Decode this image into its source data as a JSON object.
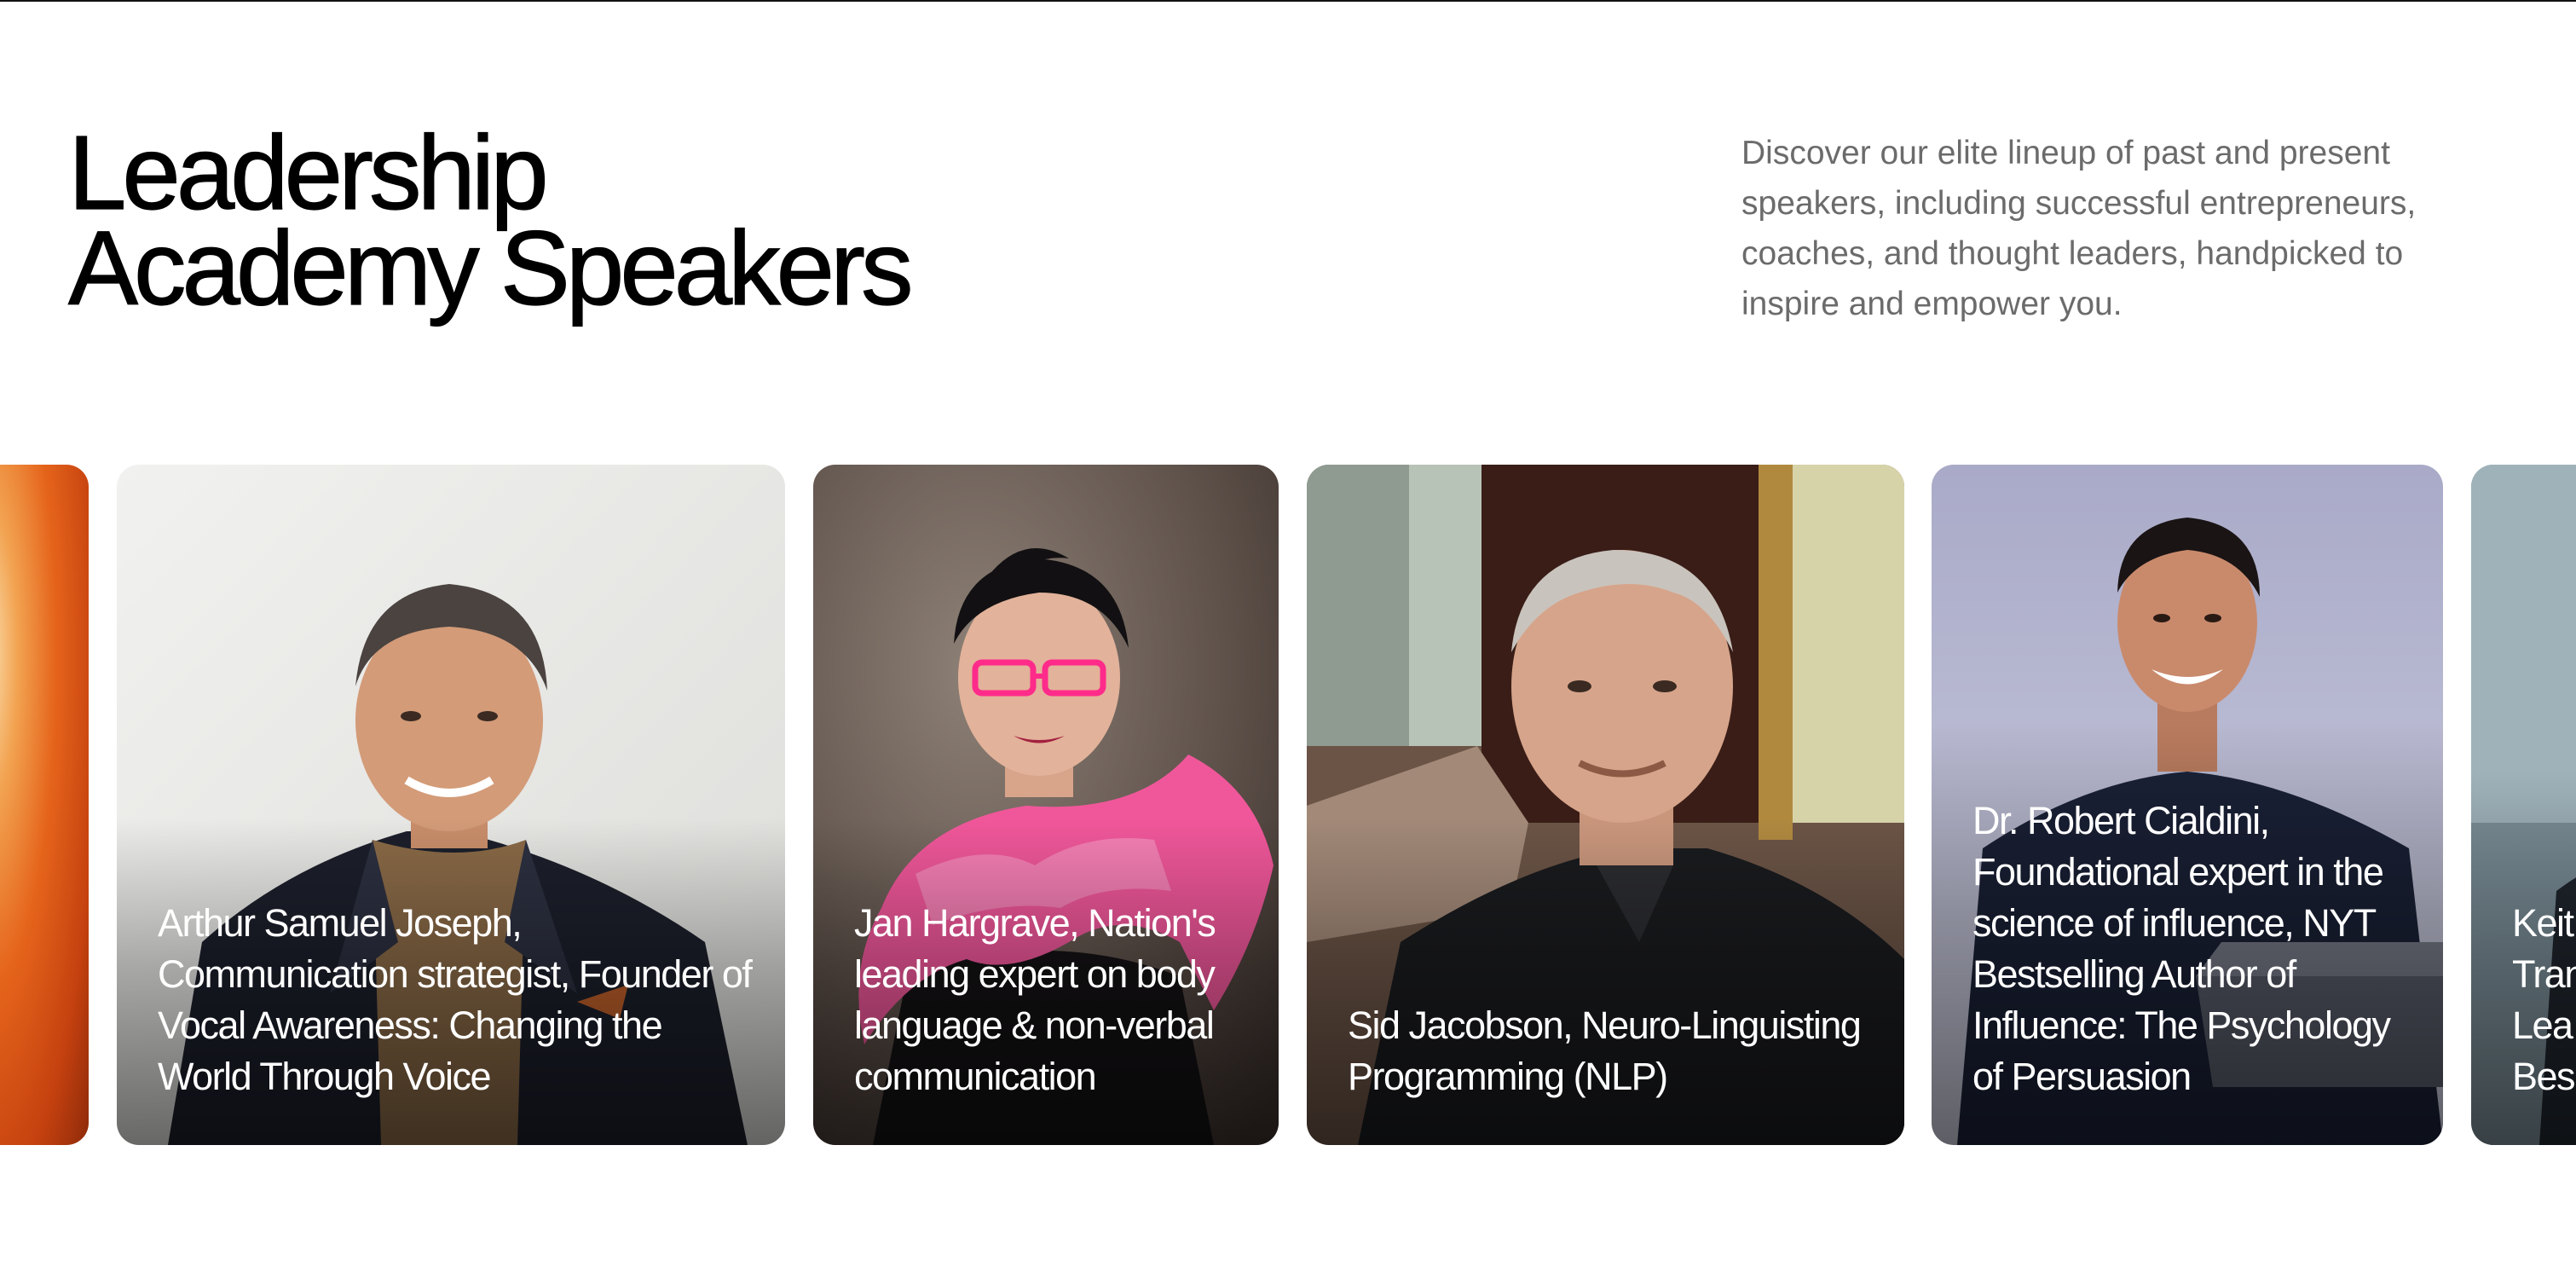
{
  "header": {
    "title_line1": "Leadership",
    "title_line2": "Academy Speakers",
    "intro": "Discover our elite lineup of past and present speakers, including successful entrepreneurs, coaches, and thought leaders, handpicked to inspire and empower you."
  },
  "speakers": [
    {
      "caption": "Arthur Samuel Joseph, Communication strategist, Founder of Vocal Awareness: Changing the World Through Voice"
    },
    {
      "caption": "Jan Hargrave, Nation's leading expert on body language & non-verbal communication"
    },
    {
      "caption": "Sid Jacobson, Neuro-Linguisting Programming (NLP)"
    },
    {
      "caption": "Dr. Robert Cialdini, Foundational expert in the science of influence, NYT Bestselling Author of Influence: The Psychology of Persuasion"
    },
    {
      "caption_lines": [
        "Keit",
        "Tran",
        "Lea",
        "Bes"
      ]
    }
  ]
}
